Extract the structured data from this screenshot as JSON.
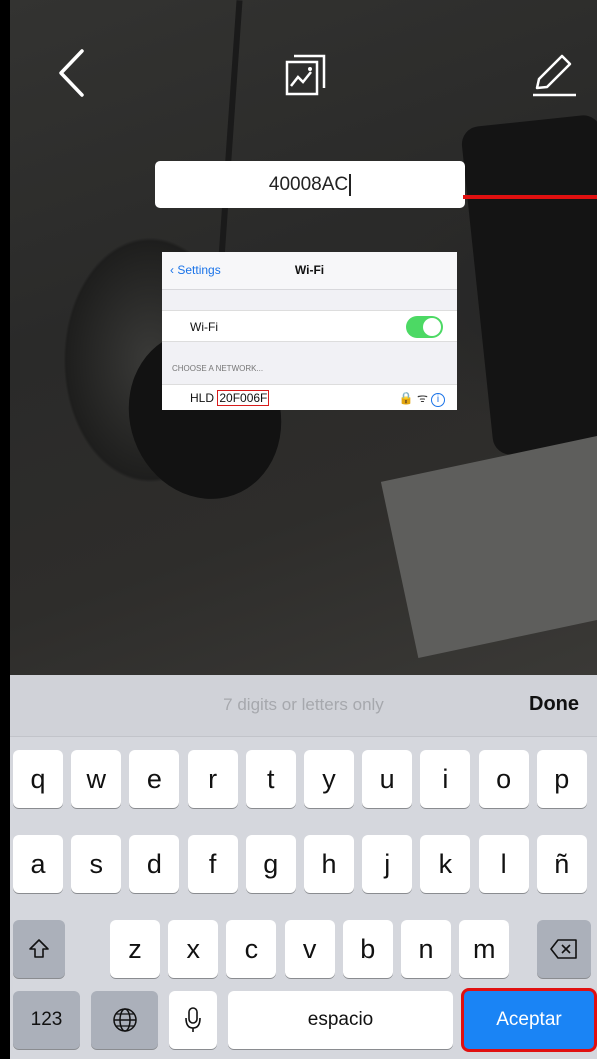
{
  "topbar": {
    "back_icon": "chevron-left-icon",
    "gallery_icon": "gallery-icon",
    "edit_icon": "pencil-icon"
  },
  "code_input": {
    "value": "40008AC"
  },
  "help_image": {
    "back_label": "Settings",
    "title": "Wi-Fi",
    "wifi_label": "Wi-Fi",
    "section_label": "CHOOSE A NETWORK...",
    "network_prefix": "HLD",
    "network_code": "20F006F",
    "info_glyph": "i"
  },
  "keyboard": {
    "hint": "7 digits or letters only",
    "done_label": "Done",
    "row1": [
      "q",
      "w",
      "e",
      "r",
      "t",
      "y",
      "u",
      "i",
      "o",
      "p"
    ],
    "row2": [
      "a",
      "s",
      "d",
      "f",
      "g",
      "h",
      "j",
      "k",
      "l",
      "ñ"
    ],
    "row3": [
      "z",
      "x",
      "c",
      "v",
      "b",
      "n",
      "m"
    ],
    "numbers_label": "123",
    "space_label": "espacio",
    "accept_label": "Aceptar",
    "colors": {
      "accept": "#1a84f5",
      "highlight": "#e01010"
    }
  }
}
